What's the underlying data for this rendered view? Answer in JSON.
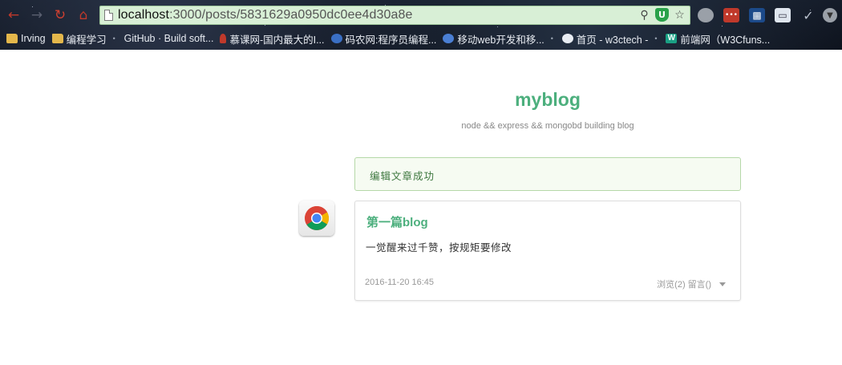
{
  "browser": {
    "url_host": "localhost",
    "url_path": ":3000/posts/5831629a0950dc0ee4d30a8e",
    "bookmarks": [
      {
        "label": "Irving",
        "icon": "folder-icon"
      },
      {
        "label": "编程学习",
        "icon": "folder-icon"
      },
      {
        "label": "GitHub · Build soft...",
        "icon": "github-icon"
      },
      {
        "label": "慕课网-国内最大的I...",
        "icon": "imooc-icon"
      },
      {
        "label": "码农网:程序员编程...",
        "icon": "codeceo-icon"
      },
      {
        "label": "移动web开发和移...",
        "icon": "feather-icon"
      },
      {
        "label": "首页 - w3ctech -",
        "icon": "w3ctech-icon"
      },
      {
        "label": "前端网（W3Cfuns...",
        "icon": "w3cfuns-icon"
      }
    ]
  },
  "site": {
    "title": "myblog",
    "subtitle": "node && express && mongobd building blog"
  },
  "flash": {
    "message": "编辑文章成功"
  },
  "post": {
    "title": "第一篇blog",
    "body": "一觉醒来过千赞，按规矩要修改",
    "date": "2016-11-20 16:45",
    "meta": "浏览(2) 留言()"
  },
  "colors": {
    "accent": "#4caf7d",
    "flash_border": "#b5d8a8",
    "flash_text": "#3c763d"
  }
}
